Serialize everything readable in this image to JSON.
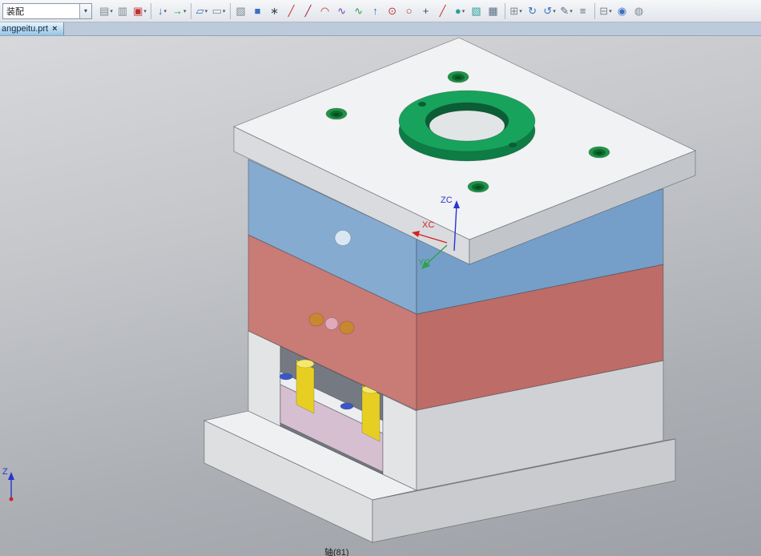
{
  "toolbar": {
    "combo_value": "装配",
    "combo_arrow": "▾",
    "icons": [
      {
        "name": "paste-icon",
        "glyph": "▤",
        "dd": "▾"
      },
      {
        "name": "copy-icon",
        "glyph": "▥",
        "dd": ""
      },
      {
        "name": "part-family-icon",
        "glyph": "▣",
        "dd": "▾"
      },
      {
        "name": "promote-body-icon",
        "glyph": "↓",
        "dd": "▾"
      },
      {
        "name": "wave-link-icon",
        "glyph": "→",
        "dd": "▾"
      },
      {
        "name": "sketch-icon",
        "glyph": "▱",
        "dd": "▾"
      },
      {
        "name": "select-rect-icon",
        "glyph": "▭",
        "dd": "▾"
      },
      {
        "name": "datum-csys-icon",
        "glyph": "▧",
        "dd": ""
      },
      {
        "name": "block-icon",
        "glyph": "■",
        "dd": ""
      },
      {
        "name": "point-set-icon",
        "glyph": "∗",
        "dd": ""
      },
      {
        "name": "line-icon",
        "glyph": "╱",
        "dd": ""
      },
      {
        "name": "profile-line-icon",
        "glyph": "╱",
        "dd": ""
      },
      {
        "name": "arc-icon",
        "glyph": "◠",
        "dd": ""
      },
      {
        "name": "spline-icon",
        "glyph": "∿",
        "dd": ""
      },
      {
        "name": "studio-spline-icon",
        "glyph": "∿",
        "dd": ""
      },
      {
        "name": "extrude-icon",
        "glyph": "↑",
        "dd": ""
      },
      {
        "name": "hole-icon",
        "glyph": "⊙",
        "dd": ""
      },
      {
        "name": "circle-icon",
        "glyph": "○",
        "dd": ""
      },
      {
        "name": "point-icon",
        "glyph": "+",
        "dd": ""
      },
      {
        "name": "line2-icon",
        "glyph": "╱",
        "dd": ""
      },
      {
        "name": "sphere-icon",
        "glyph": "●",
        "dd": "▾"
      },
      {
        "name": "shell-icon",
        "glyph": "▧",
        "dd": ""
      },
      {
        "name": "grid-table-icon",
        "glyph": "▦",
        "dd": ""
      },
      {
        "name": "window-layout-icon",
        "glyph": "⊞",
        "dd": "▾"
      },
      {
        "name": "refresh-view-icon",
        "glyph": "↻",
        "dd": ""
      },
      {
        "name": "orbit-view-icon",
        "glyph": "↺",
        "dd": "▾"
      },
      {
        "name": "edit-object-display-icon",
        "glyph": "✎",
        "dd": "▾"
      },
      {
        "name": "layer-settings-icon",
        "glyph": "≡",
        "dd": ""
      },
      {
        "name": "monitor-icon",
        "glyph": "⊟",
        "dd": "▾"
      },
      {
        "name": "show-hide-icon",
        "glyph": "◉",
        "dd": ""
      },
      {
        "name": "pan-view-icon",
        "glyph": "◍",
        "dd": ""
      }
    ]
  },
  "tab_bar": {
    "tabs": [
      {
        "label": "angpeitu.prt",
        "close": "×"
      }
    ]
  },
  "viewport": {
    "status_text": "轴(81)",
    "wcs": {
      "z": "ZC",
      "x": "XC",
      "y": "YC"
    },
    "triad": {
      "z": "Z"
    }
  },
  "colors": {
    "top_plate_top": "#f0f2f3",
    "top_plate_left": "#d9dbde",
    "top_plate_right": "#c2c6ca",
    "a_plate_left": "#85abd0",
    "a_plate_right": "#759fc8",
    "b_plate_left": "#c97b76",
    "b_plate_right": "#bd6c68",
    "riser_left": "#e3e4e6",
    "riser_right": "#cfd1d4",
    "opening": "#757a82",
    "retainer": "#eceef0",
    "ejector_plate": "#d6bfd0",
    "pin_body": "#e6cf22",
    "pin_top": "#f4e96a",
    "screw_dot": "#3a57c9",
    "bottom_top": "#eef0f1",
    "bottom_left": "#dedfe1",
    "bottom_right": "#c9cbce",
    "hole_light": "#d9e7f2",
    "hole_orange": "#c9882f",
    "hole_pink": "#e2a9b9",
    "ring_top": "#17a35c",
    "ring_side": "#0d7c45",
    "ring_inner": "#0a5d35",
    "ring_hole": "#e2e5e6",
    "screw_outer": "#1f9447",
    "screw_inner": "#0d6b2f",
    "screw_center": "#084d20",
    "axis_blue": "#2a35cf",
    "axis_red": "#d42222",
    "axis_green": "#2ca24a"
  }
}
